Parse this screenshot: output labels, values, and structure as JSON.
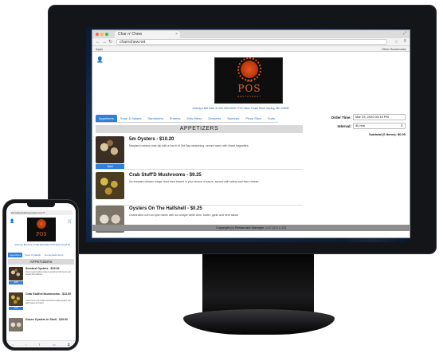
{
  "browser": {
    "tab_title": "Char n' Chew",
    "tab_close": "×",
    "url": "charnchew.net",
    "bookmarks_apps": "Apps",
    "bookmarks_other": "Other Bookmarks"
  },
  "site": {
    "logo_small": "rm",
    "logo_big": "POS",
    "logo_sub": "RESTAURANT",
    "contact": "Johnny's Bid Cafe   ✆ 000-000-0000   7720 Silver Road Silver Spring, MD 20905",
    "tabs": [
      {
        "label": "Appetizers",
        "active": true
      },
      {
        "label": "Soup & Salads"
      },
      {
        "label": "Sandwichs"
      },
      {
        "label": "Entrees"
      },
      {
        "label": "Kids Menu"
      },
      {
        "label": "Desserts"
      },
      {
        "label": "Specials"
      },
      {
        "label": "Pizza Slice"
      },
      {
        "label": "Subs"
      }
    ],
    "order_time_label": "Order Time:",
    "order_time_value": "Mar 23, 2020 03:15 PM",
    "interval_label": "Interval:",
    "interval_value": "30 min",
    "subtotal": "Subtotal (0 Items): $0.00",
    "section_title": "APPETIZERS",
    "items": [
      {
        "name": "5m Oysters - $10.20",
        "desc": "Maryland creamy crab dip with a touch of Old Bay seasoning, served warm with sliced baguettes"
      },
      {
        "name": "Crab Stuff'D Mushrooms - $9.25",
        "desc": "Un-breaded chicken wings, fried then tossed in your choice of sauce, served with celery and blue cheese."
      },
      {
        "name": "Oysters On The Halfshell - $0.25",
        "desc": "Charbroiled over an open flame with our unique white wine, butter, garlic and herb sauce"
      }
    ],
    "add_label": "Add",
    "footer": "Copyright (c) Restaurant Manager, LLC (1.0.1.12)"
  },
  "phone": {
    "url": "AA  onlineordering.rmpos.com  ↻",
    "contact": "Johnny's Bid Cafe  ✆ 000-000-0000  7720 Silver Road Silver Spring",
    "tabs": [
      {
        "label": "Appetizers",
        "active": true
      },
      {
        "label": "Soup & Salads"
      },
      {
        "label": "Homemade Soup"
      }
    ],
    "section_title": "APPETIZERS",
    "items": [
      {
        "name": "Smoked Oysters - $15.00",
        "desc": "Fresh oysters lightly smoked, garnished with lemon and served with crackers"
      },
      {
        "name": "Crab Stuffed Mushrooms - $12.00",
        "desc": "Jumbo lump crab stuffed mushrooms baked golden with garlic butter and herbs"
      },
      {
        "name": "Dozen Oysters in Shell - $19.00",
        "desc": ""
      }
    ],
    "add_label": "Add"
  },
  "colors": {
    "accent": "#2f80d9",
    "logo_orange": "#e06a2a",
    "footer_gray": "#8e8e8e"
  }
}
